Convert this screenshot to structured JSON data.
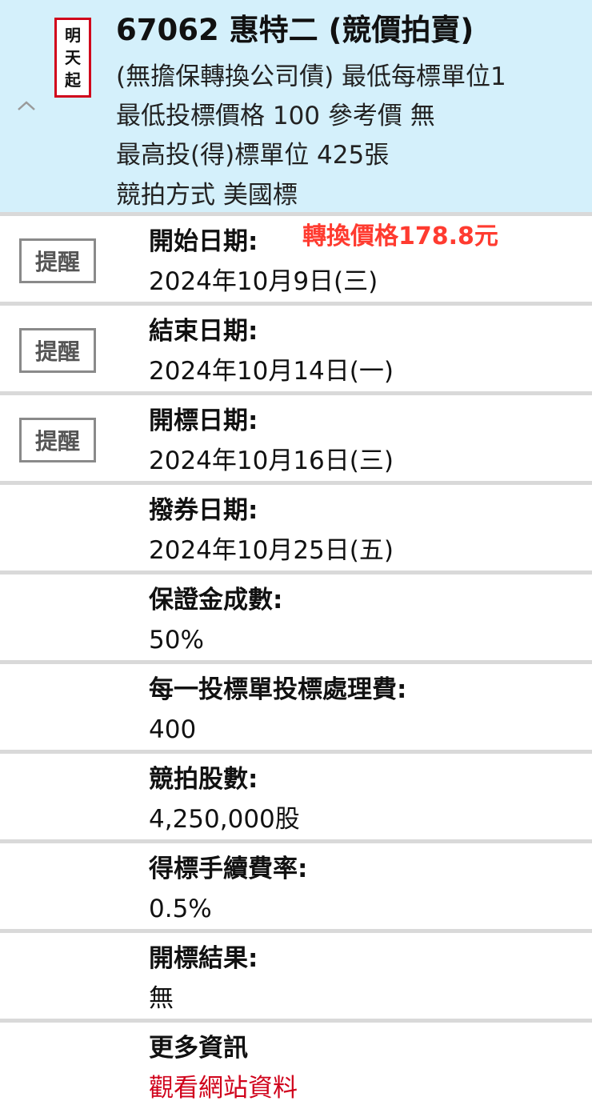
{
  "header": {
    "stamp_chars": [
      "明",
      "天",
      "起"
    ],
    "title": "67062 惠特二 (競價拍賣)",
    "line1": "(無擔保轉換公司債) 最低每標單位1",
    "line2": "最低投標價格 100 參考價 無",
    "line3": "最高投(得)標單位 425張",
    "line4": "競拍方式 美國標"
  },
  "annotation": "轉換價格178.8元",
  "remind_label": "提醒",
  "rows": [
    {
      "label": "開始日期:",
      "value": "2024年10月9日(三)"
    },
    {
      "label": "結束日期:",
      "value": "2024年10月14日(一)"
    },
    {
      "label": "開標日期:",
      "value": "2024年10月16日(三)"
    },
    {
      "label": "撥券日期:",
      "value": "2024年10月25日(五)"
    },
    {
      "label": "保證金成數:",
      "value": "50%"
    },
    {
      "label": "每一投標單投標處理費:",
      "value": "400"
    },
    {
      "label": "競拍股數:",
      "value": "4,250,000股"
    },
    {
      "label": "得標手續費率:",
      "value": "0.5%"
    },
    {
      "label": "開標結果:",
      "value": "無"
    },
    {
      "label": "更多資訊",
      "value": "觀看網站資料"
    }
  ],
  "colors": {
    "header_bg": "#d4f0fb",
    "accent_red": "#d0021b",
    "annotation_red": "#ff3b30",
    "divider": "#d9d9d9"
  }
}
